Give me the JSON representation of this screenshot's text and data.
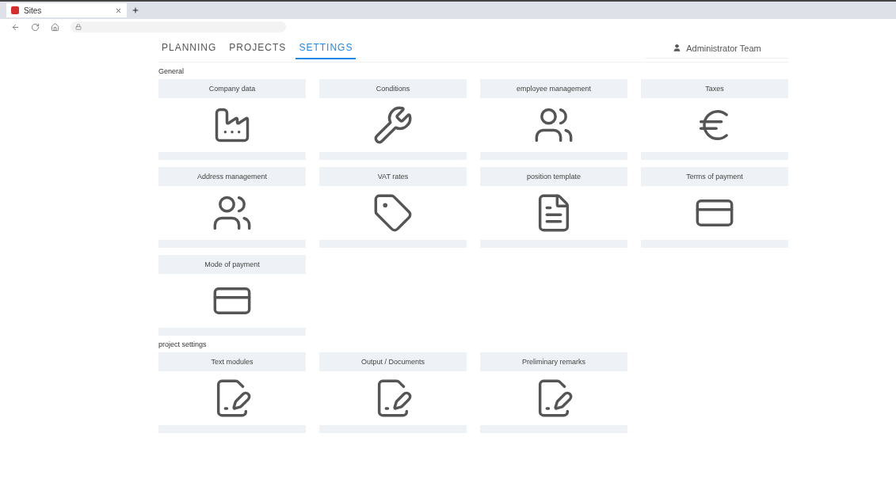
{
  "browser": {
    "tab_title": "Sites"
  },
  "nav": {
    "tabs": [
      {
        "label": "PLANNING",
        "selected": false
      },
      {
        "label": "PROJECTS",
        "selected": false
      },
      {
        "label": "SETTINGS",
        "selected": true
      }
    ],
    "user": "Administrator Team"
  },
  "sections": [
    {
      "title": "General",
      "cards": [
        {
          "label": "Company data",
          "kind": "factory"
        },
        {
          "label": "Conditions",
          "kind": "wrench"
        },
        {
          "label": "employee management",
          "kind": "people"
        },
        {
          "label": "Taxes",
          "kind": "euro"
        },
        {
          "label": "Address management",
          "kind": "people"
        },
        {
          "label": "VAT rates",
          "kind": "tag"
        },
        {
          "label": "position template",
          "kind": "document"
        },
        {
          "label": "Terms of payment",
          "kind": "card"
        },
        {
          "label": "Mode of payment",
          "kind": "card"
        }
      ]
    },
    {
      "title": "project settings",
      "cards": [
        {
          "label": "Text modules",
          "kind": "signature"
        },
        {
          "label": "Output / Documents",
          "kind": "signature"
        },
        {
          "label": "Preliminary remarks",
          "kind": "signature"
        }
      ]
    }
  ]
}
